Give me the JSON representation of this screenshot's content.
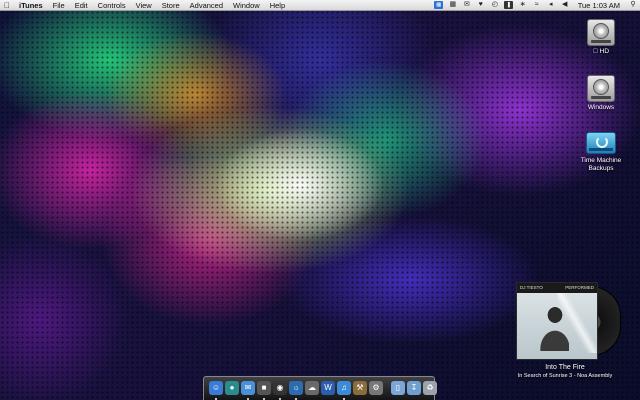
{
  "menubar": {
    "app_name": "iTunes",
    "menus": [
      "File",
      "Edit",
      "Controls",
      "View",
      "Store",
      "Advanced",
      "Window",
      "Help"
    ],
    "clock": "Tue 1:03 AM"
  },
  "desktop_icons": [
    {
      "label": "HD",
      "icon": "hard-drive-icon"
    },
    {
      "label": "Windows",
      "icon": "hard-drive-icon"
    },
    {
      "label": "Time Machine Backups",
      "icon": "time-machine-drive-icon"
    }
  ],
  "now_playing": {
    "cover_left": "DJ TIESTO",
    "cover_right": "PERFORMED",
    "title": "Into The Fire",
    "subtitle": "In Search of Sunrise 3 - Noa Assembly"
  },
  "dock": {
    "apps": [
      {
        "icon": "finder-icon",
        "color": "#3a7bd5",
        "running": true
      },
      {
        "icon": "app-icon",
        "color": "#2a8c8c",
        "running": false
      },
      {
        "icon": "mail-icon",
        "color": "#4a90d9",
        "running": true
      },
      {
        "icon": "screen-icon",
        "color": "#555555",
        "running": true
      },
      {
        "icon": "dashboard-icon",
        "color": "#333333",
        "running": true
      },
      {
        "icon": "globe-icon",
        "color": "#2b6cb0",
        "running": true
      },
      {
        "icon": "network-icon",
        "color": "#6a6a6a",
        "running": false
      },
      {
        "icon": "word-icon",
        "color": "#2b5fae",
        "running": false
      },
      {
        "icon": "itunes-icon",
        "color": "#3c8bd8",
        "running": true
      },
      {
        "icon": "tool-icon",
        "color": "#8a6d3b",
        "running": false
      },
      {
        "icon": "preferences-icon",
        "color": "#777777",
        "running": false
      }
    ],
    "stacks": [
      {
        "icon": "documents-folder-icon",
        "color": "#7aa7d8"
      },
      {
        "icon": "downloads-folder-icon",
        "color": "#6f9fd0"
      },
      {
        "icon": "trash-icon",
        "color": "#9aa3ad"
      }
    ]
  }
}
